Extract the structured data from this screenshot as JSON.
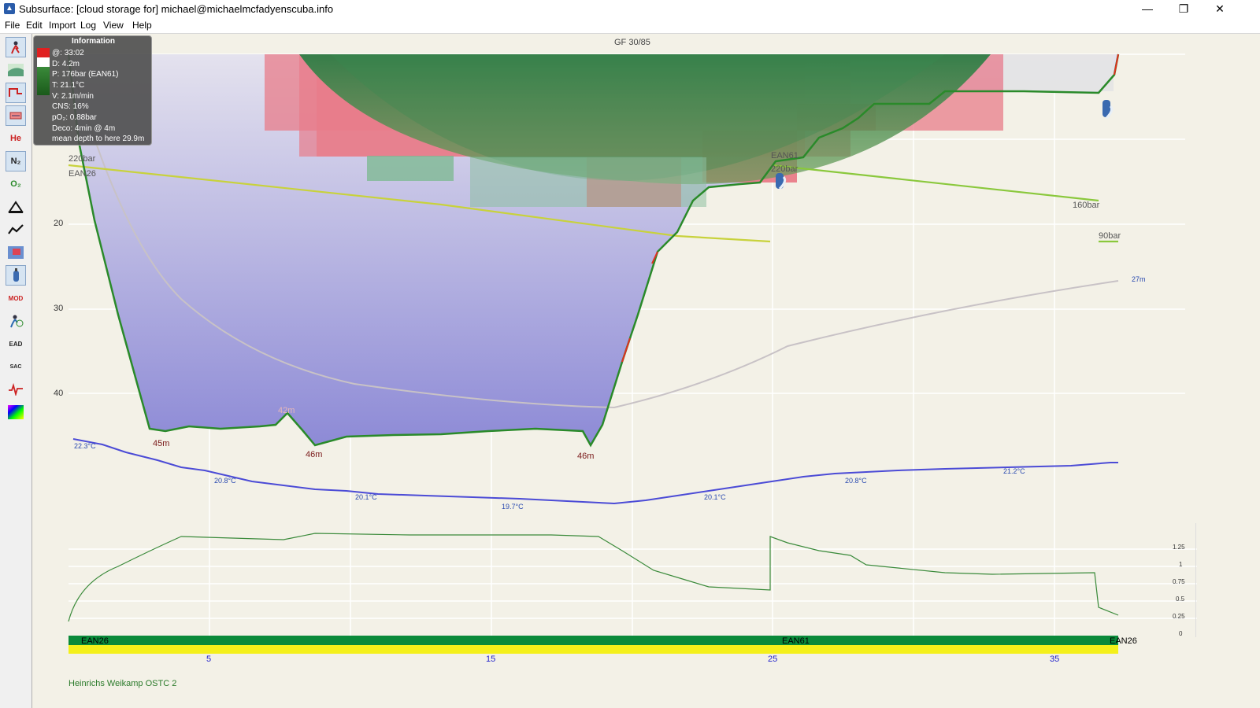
{
  "window": {
    "title": "Subsurface: [cloud storage for] michael@michaelmcfadyenscuba.info",
    "controls": [
      "—",
      "❐",
      "✕"
    ]
  },
  "menu": [
    "File",
    "Edit",
    "Import",
    "Log",
    "View",
    "Help"
  ],
  "toolbar": [
    {
      "icon": "diver-icon",
      "label": ""
    },
    {
      "icon": "profile-graph-icon",
      "label": ""
    },
    {
      "icon": "ceiling-icon",
      "label": ""
    },
    {
      "icon": "calculated-ceiling-icon",
      "label": ""
    },
    {
      "icon": "helium-icon",
      "label": "He"
    },
    {
      "icon": "nitrogen-icon",
      "label": "N₂"
    },
    {
      "icon": "oxygen-icon",
      "label": "O₂"
    },
    {
      "icon": "ruler-icon",
      "label": ""
    },
    {
      "icon": "line-graph-icon",
      "label": ""
    },
    {
      "icon": "heatmap-icon",
      "label": ""
    },
    {
      "icon": "tank-icon",
      "label": ""
    },
    {
      "icon": "mod-icon",
      "label": "MOD"
    },
    {
      "icon": "ndl-icon",
      "label": ""
    },
    {
      "icon": "ead-icon",
      "label": "EAD"
    },
    {
      "icon": "sac-icon",
      "label": "SAC"
    },
    {
      "icon": "heartrate-icon",
      "label": ""
    },
    {
      "icon": "tissue-heatmap-icon",
      "label": ""
    }
  ],
  "info": {
    "title": "Information",
    "lines": [
      "@: 33:02",
      "D: 4.2m",
      "P: 176bar (EAN61)",
      "T: 21.1°C",
      "V: 2.1m/min",
      "CNS: 16%",
      "pO₂: 0.88bar",
      "Deco: 4min @ 4m",
      "mean depth to here 29.9m"
    ]
  },
  "profile": {
    "gf_label": "GF 30/85",
    "depth_ticks": [
      "20",
      "30",
      "40"
    ],
    "time_ticks": [
      "5",
      "15",
      "25",
      "35"
    ],
    "depth_labels": {
      "max1": "45m",
      "mid": "42m",
      "max2": "46m",
      "max3": "46m"
    },
    "pressure_labels": {
      "start1": "220bar",
      "start2": "220bar",
      "end1": "160bar",
      "end2": "90bar"
    },
    "gas_labels": {
      "g1": "EAN26",
      "g2": "EAN61",
      "g3": "EAN26"
    },
    "mean_depth_label": "27m",
    "temp_labels": [
      "22.3°C",
      "20.8°C",
      "20.1°C",
      "19.7°C",
      "20.1°C",
      "20.8°C",
      "21.2°C"
    ],
    "po2_ticks": [
      "1.25",
      "1",
      "0.75",
      "0.5",
      "0.25",
      "0"
    ],
    "gasbar": [
      "EAN26",
      "EAN61",
      "EAN26"
    ],
    "computer": "Heinrichs Weikamp OSTC 2"
  },
  "colors": {
    "depth_fill_top": "#d8d6ea",
    "depth_fill_bottom": "#8d8ad6",
    "ceiling_red": "#e86f7c",
    "tissue_green": "#2f8a4a",
    "temp_line": "#4b4bd6",
    "po2_line": "#3a8a3a",
    "gas_green": "#0a8a3a",
    "gas_yellow": "#f4f01a",
    "time_blue": "#2222cc"
  }
}
